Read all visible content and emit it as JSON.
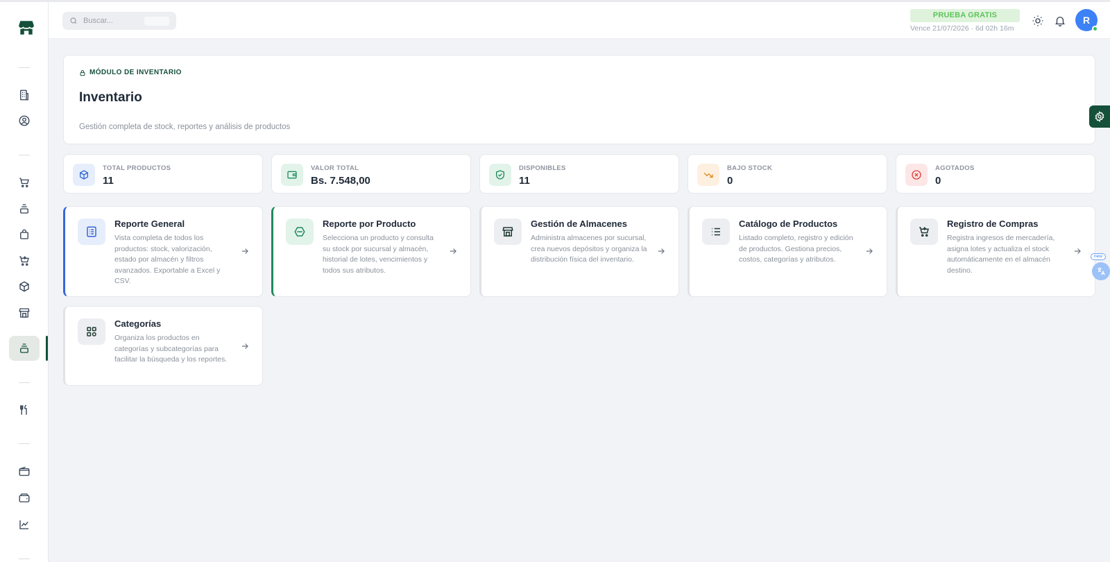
{
  "header": {
    "search_placeholder": "Buscar...",
    "trial_badge": "PRUEBA GRATIS",
    "trial_expiry": "Vence 21/07/2026 · 6d 02h 16m",
    "avatar_initial": "R"
  },
  "hero": {
    "module_tag": "MÓDULO DE INVENTARIO",
    "title": "Inventario",
    "subtitle": "Gestión completa de stock, reportes y análisis de productos"
  },
  "stats": [
    {
      "label": "TOTAL PRODUCTOS",
      "value": "11",
      "icon": "package-icon",
      "color": "#3667d6"
    },
    {
      "label": "VALOR TOTAL",
      "value": "Bs. 7.548,00",
      "icon": "wallet-icon",
      "color": "#1f8a5a"
    },
    {
      "label": "DISPONIBLES",
      "value": "11",
      "icon": "shield-check-icon",
      "color": "#1f8a5a"
    },
    {
      "label": "BAJO STOCK",
      "value": "0",
      "icon": "trending-down-icon",
      "color": "#e08a1e"
    },
    {
      "label": "AGOTADOS",
      "value": "0",
      "icon": "x-circle-icon",
      "color": "#e0413b"
    }
  ],
  "cards": [
    {
      "title": "Reporte General",
      "description": "Vista completa de todos los productos: stock, valorización, estado por almacén y filtros avanzados. Exportable a Excel y CSV.",
      "icon": "report-list-icon"
    },
    {
      "title": "Reporte por Producto",
      "description": "Selecciona un producto y consulta su stock por sucursal y almacén, historial de lotes, vencimientos y todos sus atributos.",
      "icon": "hexagon-icon"
    },
    {
      "title": "Gestión de Almacenes",
      "description": "Administra almacenes por sucursal, crea nuevos depósitos y organiza la distribución física del inventario.",
      "icon": "store-icon"
    },
    {
      "title": "Catálogo de Productos",
      "description": "Listado completo, registro y edición de productos. Gestiona precios, costos, categorías y atributos.",
      "icon": "list-icon"
    },
    {
      "title": "Registro de Compras",
      "description": "Registra ingresos de mercadería, asigna lotes y actualiza el stock automáticamente en el almacén destino.",
      "icon": "cart-plus-icon"
    },
    {
      "title": "Categorías",
      "description": "Organiza los productos en categorías y subcategorías para facilitar la búsqueda y los reportes.",
      "icon": "grid-icon"
    }
  ],
  "translate_widget": {
    "badge": "new"
  }
}
